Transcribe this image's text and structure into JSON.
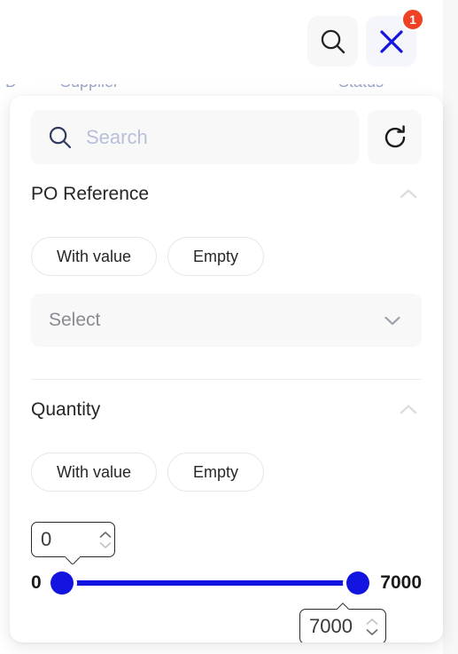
{
  "background": {
    "clipped_left_glyph": "D",
    "clipped_label_left": "Supplier",
    "clipped_label_right": "Status"
  },
  "top_actions": {
    "search_button": {
      "icon": "search-icon",
      "label": "Search"
    },
    "close_button": {
      "icon": "close-icon",
      "label": "Close",
      "badge_count": "1",
      "badge_color": "#ef4123",
      "icon_color": "#1414e0"
    }
  },
  "panel": {
    "search": {
      "placeholder": "Search",
      "value": "",
      "icon": "search-icon"
    },
    "refresh_button": {
      "icon": "refresh-icon",
      "label": "Refresh"
    },
    "groups": [
      {
        "title": "PO Reference",
        "expanded": true,
        "toggle_icon": "chevron-up-icon",
        "pills": [
          {
            "label": "With value",
            "selected": false
          },
          {
            "label": "Empty",
            "selected": false
          }
        ],
        "select": {
          "placeholder": "Select",
          "value": "",
          "icon": "chevron-down-icon"
        }
      },
      {
        "title": "Quantity",
        "expanded": true,
        "toggle_icon": "chevron-up-icon",
        "pills": [
          {
            "label": "With value",
            "selected": false
          },
          {
            "label": "Empty",
            "selected": false
          }
        ],
        "range": {
          "min_label": "0",
          "max_label": "7000",
          "lower_value": "0",
          "upper_value": "7000",
          "track_color": "#1414e0",
          "handle_color": "#1414e0",
          "spinner_icon": "stepper-arrows-icon"
        }
      }
    ]
  }
}
